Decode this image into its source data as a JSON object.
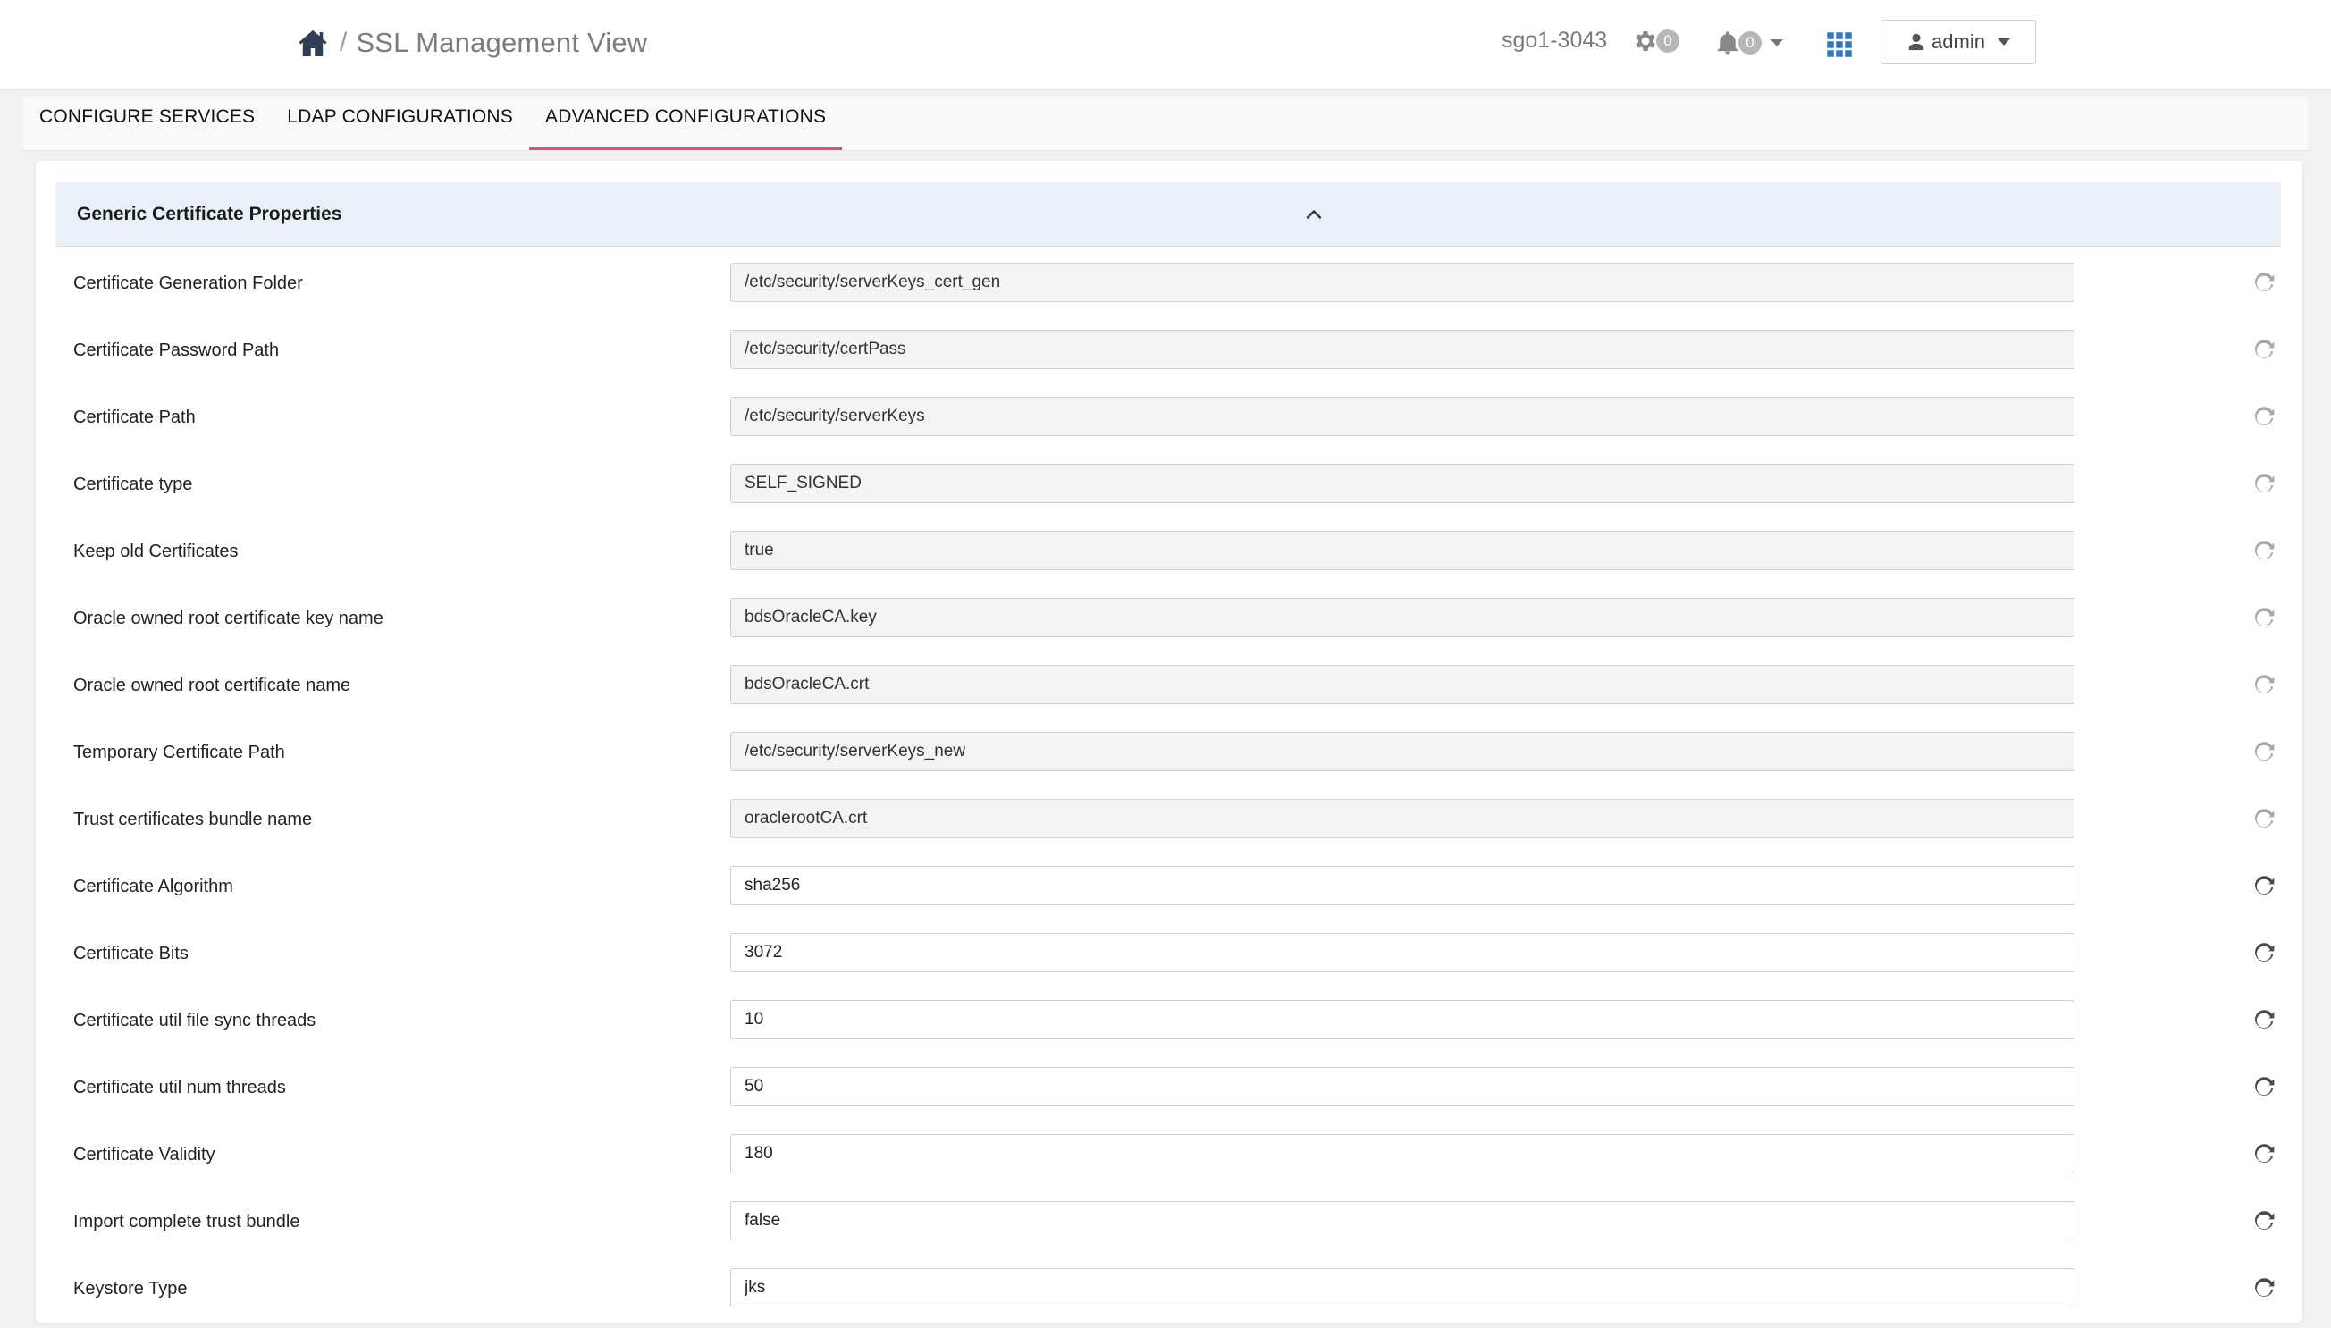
{
  "header": {
    "icons": {
      "home": "home-icon",
      "operations": "gear-icon",
      "alerts": "bell-icon",
      "apps": "grid-icon",
      "user": "user-icon"
    },
    "breadcrumb_separator": "/",
    "page_title": "SSL Management View",
    "cluster_name": "sgo1-3043",
    "ops_count": "0",
    "alerts_count": "0",
    "user_name": "admin"
  },
  "tabs": [
    {
      "label": "CONFIGURE SERVICES",
      "active": false
    },
    {
      "label": "LDAP CONFIGURATIONS",
      "active": false
    },
    {
      "label": "ADVANCED CONFIGURATIONS",
      "active": true
    }
  ],
  "section": {
    "title": "Generic Certificate Properties",
    "collapse_icon": "chevron-up-icon"
  },
  "properties": [
    {
      "label": "Certificate Generation Folder",
      "value": "/etc/security/serverKeys_cert_gen",
      "readonly": true
    },
    {
      "label": "Certificate Password Path",
      "value": "/etc/security/certPass",
      "readonly": true
    },
    {
      "label": "Certificate Path",
      "value": "/etc/security/serverKeys",
      "readonly": true
    },
    {
      "label": "Certificate type",
      "value": "SELF_SIGNED",
      "readonly": true
    },
    {
      "label": "Keep old Certificates",
      "value": "true",
      "readonly": true
    },
    {
      "label": "Oracle owned root certificate key name",
      "value": "bdsOracleCA.key",
      "readonly": true
    },
    {
      "label": "Oracle owned root certificate name",
      "value": "bdsOracleCA.crt",
      "readonly": true
    },
    {
      "label": "Temporary Certificate Path",
      "value": "/etc/security/serverKeys_new",
      "readonly": true
    },
    {
      "label": "Trust certificates bundle name",
      "value": "oraclerootCA.crt",
      "readonly": true
    },
    {
      "label": "Certificate Algorithm",
      "value": "sha256",
      "readonly": false
    },
    {
      "label": "Certificate Bits",
      "value": "3072",
      "readonly": false
    },
    {
      "label": "Certificate util file sync threads",
      "value": "10",
      "readonly": false
    },
    {
      "label": "Certificate util num threads",
      "value": "50",
      "readonly": false
    },
    {
      "label": "Certificate Validity",
      "value": "180",
      "readonly": false
    },
    {
      "label": "Import complete trust bundle",
      "value": "false",
      "readonly": false
    },
    {
      "label": "Keystore Type",
      "value": "jks",
      "readonly": false
    }
  ],
  "colors": {
    "active_tab_underline": "#d4547c",
    "section_header_bg": "#e9f0fa",
    "home_icon": "#2f3e56",
    "apps_icon": "#2f78c4",
    "badge_bg": "#b7b7b7"
  }
}
